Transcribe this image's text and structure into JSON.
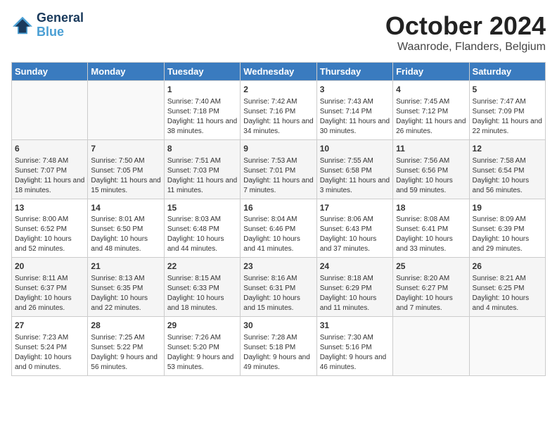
{
  "header": {
    "logo_line1": "General",
    "logo_line2": "Blue",
    "month": "October 2024",
    "location": "Waanrode, Flanders, Belgium"
  },
  "weekdays": [
    "Sunday",
    "Monday",
    "Tuesday",
    "Wednesday",
    "Thursday",
    "Friday",
    "Saturday"
  ],
  "weeks": [
    [
      {
        "day": "",
        "info": ""
      },
      {
        "day": "",
        "info": ""
      },
      {
        "day": "1",
        "info": "Sunrise: 7:40 AM\nSunset: 7:18 PM\nDaylight: 11 hours and 38 minutes."
      },
      {
        "day": "2",
        "info": "Sunrise: 7:42 AM\nSunset: 7:16 PM\nDaylight: 11 hours and 34 minutes."
      },
      {
        "day": "3",
        "info": "Sunrise: 7:43 AM\nSunset: 7:14 PM\nDaylight: 11 hours and 30 minutes."
      },
      {
        "day": "4",
        "info": "Sunrise: 7:45 AM\nSunset: 7:12 PM\nDaylight: 11 hours and 26 minutes."
      },
      {
        "day": "5",
        "info": "Sunrise: 7:47 AM\nSunset: 7:09 PM\nDaylight: 11 hours and 22 minutes."
      }
    ],
    [
      {
        "day": "6",
        "info": "Sunrise: 7:48 AM\nSunset: 7:07 PM\nDaylight: 11 hours and 18 minutes."
      },
      {
        "day": "7",
        "info": "Sunrise: 7:50 AM\nSunset: 7:05 PM\nDaylight: 11 hours and 15 minutes."
      },
      {
        "day": "8",
        "info": "Sunrise: 7:51 AM\nSunset: 7:03 PM\nDaylight: 11 hours and 11 minutes."
      },
      {
        "day": "9",
        "info": "Sunrise: 7:53 AM\nSunset: 7:01 PM\nDaylight: 11 hours and 7 minutes."
      },
      {
        "day": "10",
        "info": "Sunrise: 7:55 AM\nSunset: 6:58 PM\nDaylight: 11 hours and 3 minutes."
      },
      {
        "day": "11",
        "info": "Sunrise: 7:56 AM\nSunset: 6:56 PM\nDaylight: 10 hours and 59 minutes."
      },
      {
        "day": "12",
        "info": "Sunrise: 7:58 AM\nSunset: 6:54 PM\nDaylight: 10 hours and 56 minutes."
      }
    ],
    [
      {
        "day": "13",
        "info": "Sunrise: 8:00 AM\nSunset: 6:52 PM\nDaylight: 10 hours and 52 minutes."
      },
      {
        "day": "14",
        "info": "Sunrise: 8:01 AM\nSunset: 6:50 PM\nDaylight: 10 hours and 48 minutes."
      },
      {
        "day": "15",
        "info": "Sunrise: 8:03 AM\nSunset: 6:48 PM\nDaylight: 10 hours and 44 minutes."
      },
      {
        "day": "16",
        "info": "Sunrise: 8:04 AM\nSunset: 6:46 PM\nDaylight: 10 hours and 41 minutes."
      },
      {
        "day": "17",
        "info": "Sunrise: 8:06 AM\nSunset: 6:43 PM\nDaylight: 10 hours and 37 minutes."
      },
      {
        "day": "18",
        "info": "Sunrise: 8:08 AM\nSunset: 6:41 PM\nDaylight: 10 hours and 33 minutes."
      },
      {
        "day": "19",
        "info": "Sunrise: 8:09 AM\nSunset: 6:39 PM\nDaylight: 10 hours and 29 minutes."
      }
    ],
    [
      {
        "day": "20",
        "info": "Sunrise: 8:11 AM\nSunset: 6:37 PM\nDaylight: 10 hours and 26 minutes."
      },
      {
        "day": "21",
        "info": "Sunrise: 8:13 AM\nSunset: 6:35 PM\nDaylight: 10 hours and 22 minutes."
      },
      {
        "day": "22",
        "info": "Sunrise: 8:15 AM\nSunset: 6:33 PM\nDaylight: 10 hours and 18 minutes."
      },
      {
        "day": "23",
        "info": "Sunrise: 8:16 AM\nSunset: 6:31 PM\nDaylight: 10 hours and 15 minutes."
      },
      {
        "day": "24",
        "info": "Sunrise: 8:18 AM\nSunset: 6:29 PM\nDaylight: 10 hours and 11 minutes."
      },
      {
        "day": "25",
        "info": "Sunrise: 8:20 AM\nSunset: 6:27 PM\nDaylight: 10 hours and 7 minutes."
      },
      {
        "day": "26",
        "info": "Sunrise: 8:21 AM\nSunset: 6:25 PM\nDaylight: 10 hours and 4 minutes."
      }
    ],
    [
      {
        "day": "27",
        "info": "Sunrise: 7:23 AM\nSunset: 5:24 PM\nDaylight: 10 hours and 0 minutes."
      },
      {
        "day": "28",
        "info": "Sunrise: 7:25 AM\nSunset: 5:22 PM\nDaylight: 9 hours and 56 minutes."
      },
      {
        "day": "29",
        "info": "Sunrise: 7:26 AM\nSunset: 5:20 PM\nDaylight: 9 hours and 53 minutes."
      },
      {
        "day": "30",
        "info": "Sunrise: 7:28 AM\nSunset: 5:18 PM\nDaylight: 9 hours and 49 minutes."
      },
      {
        "day": "31",
        "info": "Sunrise: 7:30 AM\nSunset: 5:16 PM\nDaylight: 9 hours and 46 minutes."
      },
      {
        "day": "",
        "info": ""
      },
      {
        "day": "",
        "info": ""
      }
    ]
  ]
}
